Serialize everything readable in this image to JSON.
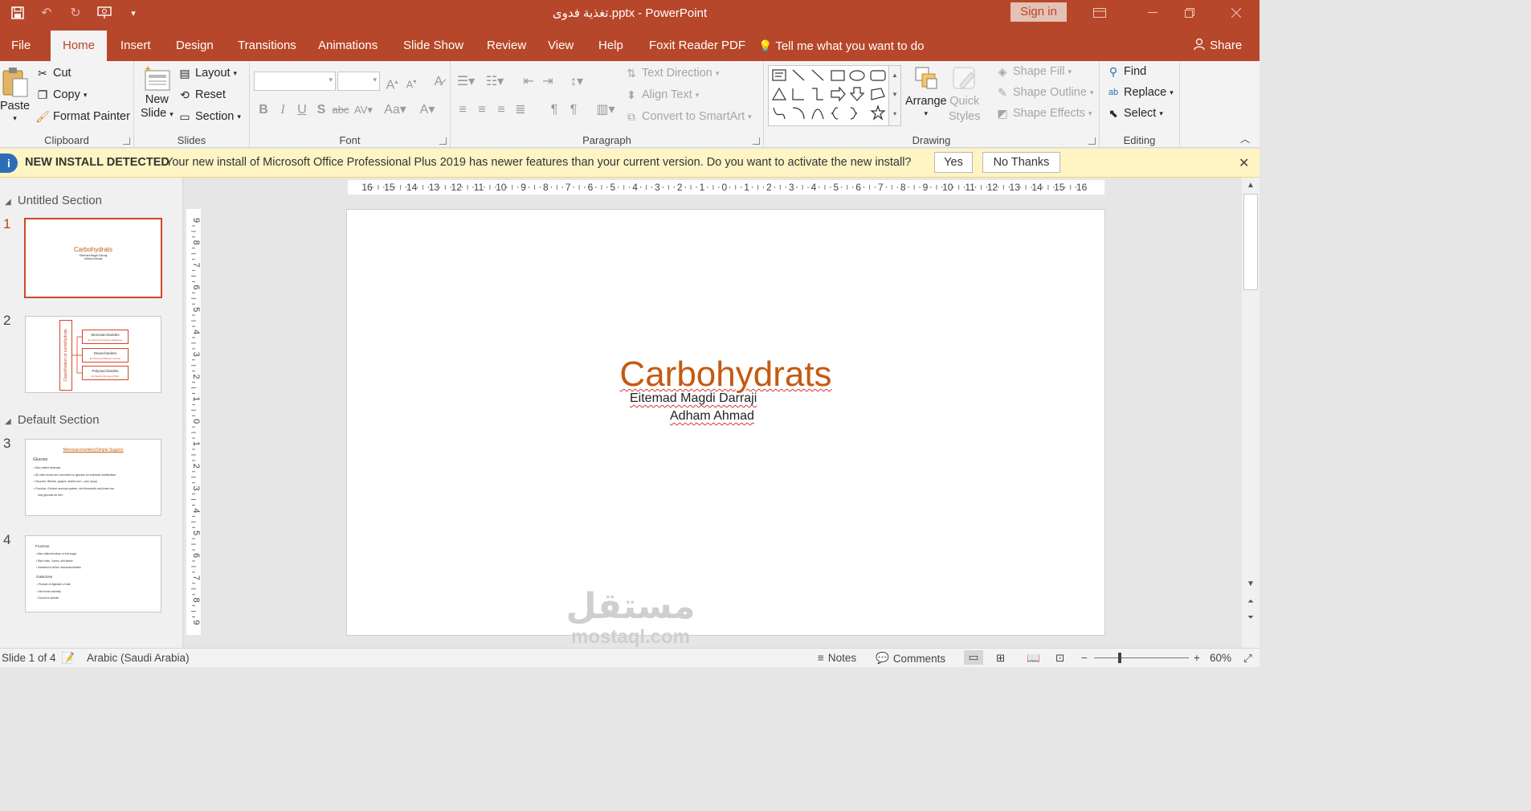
{
  "titlebar": {
    "doc_title": "تغذية فدوى.pptx  -  PowerPoint",
    "sign_in": "Sign in"
  },
  "tabs": [
    "File",
    "Home",
    "Insert",
    "Design",
    "Transitions",
    "Animations",
    "Slide Show",
    "Review",
    "View",
    "Help",
    "Foxit Reader PDF"
  ],
  "tell_me": "Tell me what you want to do",
  "share": "Share",
  "ribbon": {
    "clipboard": {
      "label": "Clipboard",
      "paste": "Paste",
      "cut": "Cut",
      "copy": "Copy",
      "format_painter": "Format Painter"
    },
    "slides": {
      "label": "Slides",
      "new_slide_1": "New",
      "new_slide_2": "Slide",
      "layout": "Layout",
      "reset": "Reset",
      "section": "Section"
    },
    "font": {
      "label": "Font"
    },
    "paragraph": {
      "label": "Paragraph",
      "text_direction": "Text Direction",
      "align_text": "Align Text",
      "convert_smartart": "Convert to SmartArt"
    },
    "drawing": {
      "label": "Drawing",
      "arrange": "Arrange",
      "quick_styles_1": "Quick",
      "quick_styles_2": "Styles",
      "shape_fill": "Shape Fill",
      "shape_outline": "Shape Outline",
      "shape_effects": "Shape Effects"
    },
    "editing": {
      "label": "Editing",
      "find": "Find",
      "replace": "Replace",
      "select": "Select"
    }
  },
  "notification": {
    "title": "NEW INSTALL DETECTED",
    "message": "Your new install of Microsoft Office Professional Plus 2019 has newer features than your current version. Do you want to activate the new install?",
    "yes": "Yes",
    "no": "No Thanks"
  },
  "thumbnails": {
    "section1": "Untitled Section",
    "section2": "Default Section",
    "slides": [
      {
        "num": "1",
        "title": "Carbohydrats",
        "lines": [
          "Eitemad Magdi Darraji",
          "Adham Ahmad"
        ]
      },
      {
        "num": "2",
        "vertical": "Classification of carbohydrats",
        "boxes": [
          {
            "title": "Monosaccharides",
            "sub": "Ex:Glucose,Fructose,Galactose"
          },
          {
            "title": "Disaccharides",
            "sub": "Ex:Sucrose,Maltose,Lactose"
          },
          {
            "title": "Polysaccharides",
            "sub": "Ex:Starch,Glycogen,Fiber"
          }
        ]
      },
      {
        "num": "3",
        "title": "Monosaccharides(Simple Sugars)",
        "heading": "Glucose",
        "bullets": [
          "Also called dextrose.",
          "All other forms are converted to glucose for eventual metabolism.",
          "Sources: Berries ,grapes ,sweet corn , corn syrup.",
          "Function :Central nervous system ,red  bloodcells and brain use",
          "only glucose as fuel."
        ]
      },
      {
        "num": "4",
        "heading1": "Fructose",
        "bullets1": [
          "Also called levulose or fruit sugar",
          "Ripe fruits , honey ,soft drinks",
          "Sweetest of all the monosaccharides"
        ],
        "heading2": "Galactose",
        "bullets2": [
          "Product  of digestion of milk",
          "Not found naturally",
          "Source is lactose"
        ]
      }
    ]
  },
  "slide": {
    "title": "Carbohydrats",
    "subtitle_line1": "Eitemad Magdi Darraji",
    "subtitle_line2": "Adham Ahmad"
  },
  "ruler": {
    "ticks": [
      "16",
      "15",
      "14",
      "13",
      "12",
      "11",
      "10",
      "9",
      "8",
      "7",
      "6",
      "5",
      "4",
      "3",
      "2",
      "1",
      "0",
      "1",
      "2",
      "3",
      "4",
      "5",
      "6",
      "7",
      "8",
      "9",
      "10",
      "11",
      "12",
      "13",
      "14",
      "15",
      "16"
    ],
    "vticks": [
      "9",
      "8",
      "7",
      "6",
      "5",
      "4",
      "3",
      "2",
      "1",
      "0",
      "1",
      "2",
      "3",
      "4",
      "5",
      "6",
      "7",
      "8",
      "9"
    ]
  },
  "status": {
    "slide_counter": "Slide 1 of 4",
    "language": "Arabic (Saudi Arabia)",
    "notes": "Notes",
    "comments": "Comments",
    "zoom": "60%"
  },
  "watermark": {
    "arabic": "مستقل",
    "latin": "mostaql.com"
  },
  "colors": {
    "accent": "#b7472a",
    "title_orange": "#c55a11",
    "notify_bg": "#fff4c3"
  }
}
